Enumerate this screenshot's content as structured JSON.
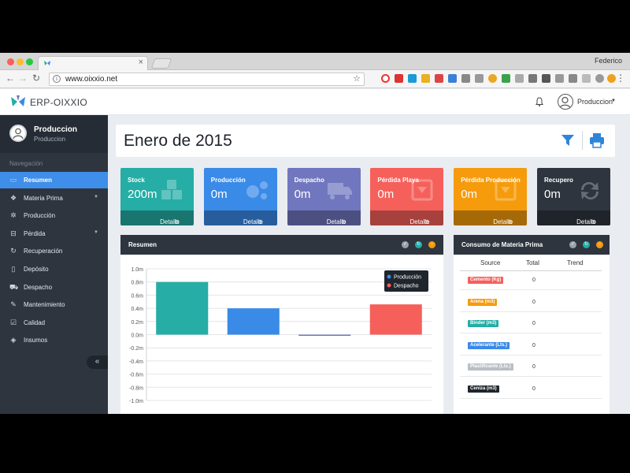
{
  "browser": {
    "user": "Federico",
    "url": "www.oixxio.net"
  },
  "app": {
    "logo_text": "ERP-OIXXIO",
    "header_user": "Produccion"
  },
  "sidebar": {
    "profile_name": "Produccion",
    "profile_role": "Produccion",
    "section_label": "Navegación",
    "items": [
      {
        "label": "Resumen",
        "icon": "laptop-icon",
        "active": true,
        "has_children": false
      },
      {
        "label": "Materia Prima",
        "icon": "cubes-icon",
        "active": false,
        "has_children": true
      },
      {
        "label": "Producción",
        "icon": "cogs-icon",
        "active": false,
        "has_children": false
      },
      {
        "label": "Pérdida",
        "icon": "minus-square-icon",
        "active": false,
        "has_children": true
      },
      {
        "label": "Recuperación",
        "icon": "refresh-icon",
        "active": false,
        "has_children": false
      },
      {
        "label": "Depósito",
        "icon": "file-icon",
        "active": false,
        "has_children": false
      },
      {
        "label": "Despacho",
        "icon": "truck-icon",
        "active": false,
        "has_children": false
      },
      {
        "label": "Mantenimiento",
        "icon": "wrench-icon",
        "active": false,
        "has_children": false
      },
      {
        "label": "Calidad",
        "icon": "check-square-icon",
        "active": false,
        "has_children": false
      },
      {
        "label": "Insumos",
        "icon": "cube-icon",
        "active": false,
        "has_children": false
      }
    ],
    "collapse_label": "«"
  },
  "page": {
    "title": "Enero de 2015"
  },
  "cards": [
    {
      "title": "Stock",
      "value": "200m",
      "footer": "Detalle",
      "color": "#25ada6",
      "icon": "cubes-icon"
    },
    {
      "title": "Producción",
      "value": "0m",
      "footer": "Detalle",
      "color": "#3a8ae8",
      "icon": "cogs-icon"
    },
    {
      "title": "Despacho",
      "value": "0m",
      "footer": "Detalle",
      "color": "#7077bf",
      "icon": "truck-icon"
    },
    {
      "title": "Pérdida Playa",
      "value": "0m",
      "footer": "Detalle",
      "color": "#f5605b",
      "icon": "minus-square-icon"
    },
    {
      "title": "Pérdida Producción",
      "value": "0m",
      "footer": "Detalle",
      "color": "#f59b0c",
      "icon": "minus-square-icon"
    },
    {
      "title": "Recupero",
      "value": "0m",
      "footer": "Detalle",
      "color": "#2e353f",
      "icon": "refresh-icon"
    }
  ],
  "resumen_panel": {
    "title": "Resumen"
  },
  "chart_data": {
    "type": "bar",
    "categories": [
      "",
      "",
      "",
      ""
    ],
    "values": [
      0.8,
      0.4,
      0.0,
      0.46
    ],
    "colors": [
      "#25ada6",
      "#3a8ae8",
      "#7077bf",
      "#f5605b"
    ],
    "ylim": [
      -1.0,
      1.0
    ],
    "yticks": [
      "1.0m",
      "0.8m",
      "0.6m",
      "0.4m",
      "0.2m",
      "0.0m",
      "-0.2m",
      "-0.4m",
      "-0.6m",
      "-0.8m",
      "-1.0m"
    ],
    "ytick_values": [
      1.0,
      0.8,
      0.6,
      0.4,
      0.2,
      0.0,
      -0.2,
      -0.4,
      -0.6,
      -0.8,
      -1.0
    ],
    "grid": true,
    "legend_position": "top-right",
    "legend": [
      {
        "name": "Producción",
        "color": "#3a8ae8"
      },
      {
        "name": "Despacho",
        "color": "#f5605b"
      }
    ]
  },
  "consumo_panel": {
    "title": "Consumo de Materia Prima",
    "columns": [
      "Source",
      "Total",
      "Trend"
    ],
    "rows": [
      {
        "source": "Cemento (Kg)",
        "total": "0",
        "color": "#f5605b"
      },
      {
        "source": "Arena (m3)",
        "total": "0",
        "color": "#f59b0c"
      },
      {
        "source": "Binder (m3)",
        "total": "0",
        "color": "#25ada6"
      },
      {
        "source": "Acelerante (Lts.)",
        "total": "0",
        "color": "#3a8ae8"
      },
      {
        "source": "Plastificante (Lts.)",
        "total": "0",
        "color": "#b9bec6"
      },
      {
        "source": "Ceniza (m3)",
        "total": "0",
        "color": "#1f252c"
      }
    ]
  }
}
